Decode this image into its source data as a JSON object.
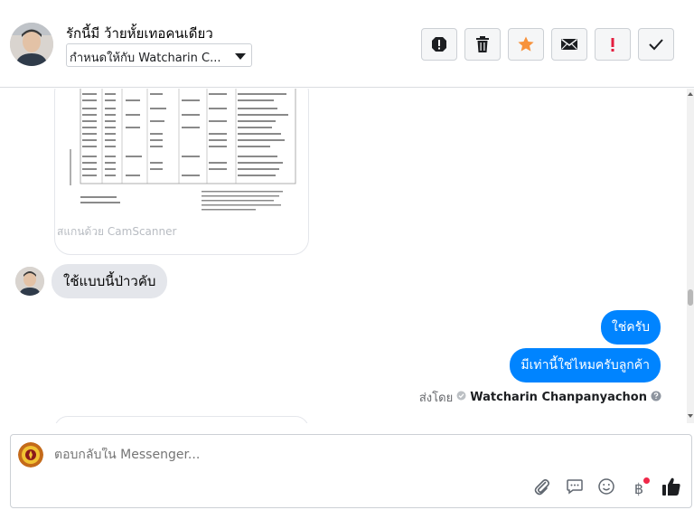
{
  "header": {
    "contact_name": "รักนี้มี ว้ายหั้ยเทอคนเดียว",
    "assign_value": "กำหนดให้กับ Watcharin C...",
    "actions": [
      {
        "name": "spam-report",
        "icon": "exclamation-circle-icon"
      },
      {
        "name": "delete",
        "icon": "trash-icon"
      },
      {
        "name": "star",
        "icon": "star-icon",
        "color": "#f7923b"
      },
      {
        "name": "mark-unread",
        "icon": "envelope-icon"
      },
      {
        "name": "follow-up",
        "icon": "exclamation-icon",
        "color": "#e41e3f"
      },
      {
        "name": "mark-done",
        "icon": "checkmark-icon"
      }
    ]
  },
  "conversation": {
    "image_caption": "สแกนด้วย CamScanner",
    "incoming": [
      {
        "text": "ใช้แบบนี้ป่าวคับ"
      }
    ],
    "outgoing": [
      {
        "text": "ใช่ครับ"
      },
      {
        "text": "มีเท่านี้ใช่ไหมครับลูกค้า"
      }
    ],
    "sent_by_label": "ส่งโดย",
    "sent_by_agent": "Watcharin Chanpanyachon"
  },
  "composer": {
    "placeholder": "ตอบกลับใน Messenger...",
    "tools": [
      "paperclip-icon",
      "saved-reply-icon",
      "emoji-icon",
      "payment-icon",
      "thumbs-up-icon"
    ],
    "payment_symbol": "฿"
  },
  "colors": {
    "accent_blue": "#0084ff",
    "incoming_bubble": "#e4e6eb",
    "star": "#f7923b",
    "flag": "#e41e3f",
    "badge_dot": "#f02849"
  }
}
